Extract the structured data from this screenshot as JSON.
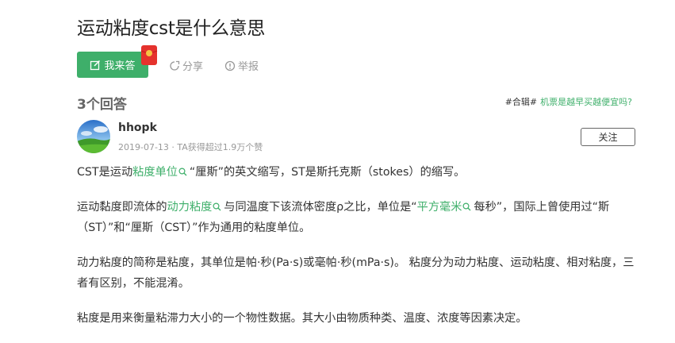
{
  "page": {
    "title": "运动粘度cst是什么意思"
  },
  "actions": {
    "answer_label": "我来答",
    "share_label": "分享",
    "report_label": "举报"
  },
  "answers": {
    "count_label": "3个回答",
    "topic_tag": "#合辑#",
    "topic_link": "机票是越早买越便宜吗?"
  },
  "answer": {
    "username": "hhopk",
    "meta": "2019-07-13 · TA获得超过1.9万个赞",
    "follow_label": "关注",
    "p1": {
      "a": "CST是运动",
      "kw": "粘度单位",
      "b": "“厘斯”的英文缩写，ST是斯托克斯（stokes）的缩写。"
    },
    "p2": {
      "a": "运动黏度即流体的",
      "kw1": "动力粘度",
      "b": "与同温度下该流体密度ρ之比，单位是“",
      "kw2": "平方毫米",
      "c": "每秒”，国际上曾使用过“斯（ST）”和“厘斯（CST）”作为通用的粘度单位。"
    },
    "p3": "动力粘度的简称是粘度，其单位是帕·秒(Pa·s)或毫帕·秒(mPa·s)。 粘度分为动力粘度、运动粘度、相对粘度，三者有区别，不能混淆。",
    "p4": "粘度是用来衡量粘滞力大小的一个物性数据。其大小由物质种类、温度、浓度等因素决定。"
  },
  "colors": {
    "accent": "#3eaf6a",
    "redpack": "#e5322d"
  },
  "icons": [
    "edit-icon",
    "red-packet-icon",
    "share-icon",
    "report-icon",
    "search-icon"
  ]
}
